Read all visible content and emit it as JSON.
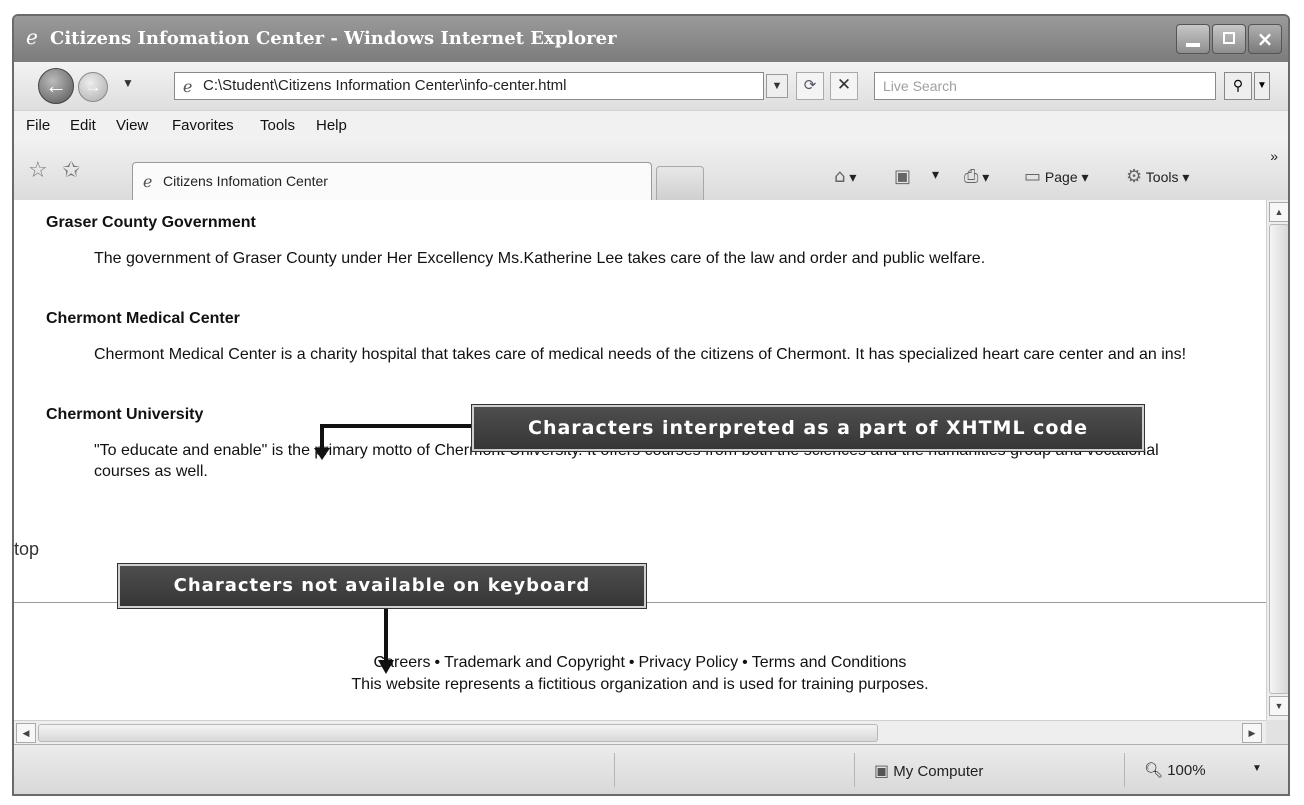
{
  "window": {
    "title": "Citizens Infomation Center - Windows Internet Explorer",
    "buttons": {
      "minimize": "minimize-icon",
      "maximize": "maximize-icon",
      "close": "×"
    }
  },
  "navbar": {
    "address": "C:\\Student\\Citizens Information Center\\info-center.html",
    "search_placeholder": "Live Search",
    "back_glyph": "←",
    "forward_glyph": "→",
    "dropdown_glyph": "▼",
    "refresh_glyph": "⟳",
    "stop_glyph": "✕",
    "search_glyph": "⚲"
  },
  "menu": {
    "items": [
      "File",
      "Edit",
      "View",
      "Favorites",
      "Tools",
      "Help"
    ]
  },
  "tabbar": {
    "tab_label": "Citizens Infomation Center",
    "page_label": "Page",
    "tools_label": "Tools",
    "more_glyph": "»"
  },
  "content": {
    "sections": [
      {
        "title": "Graser County Government",
        "body": "The government of Graser County under Her Excellency Ms.Katherine Lee takes care of the law and order and public welfare."
      },
      {
        "title": "Chermont Medical Center",
        "body": "Chermont Medical Center is a charity hospital that takes care of medical needs of the citizens of Chermont. It has specialized heart care center and an ins!"
      },
      {
        "title": "Chermont University",
        "body": "\"To educate and enable\" is the primary motto of Chermont University. It offers courses from both the sciences and the humanities group and vocational courses as well."
      }
    ],
    "top_link": "top",
    "footer_links": [
      "Careers",
      "Trademark and Copyright",
      "Privacy Policy",
      "Terms and Conditions"
    ],
    "footer_separator": "•",
    "footer_note": "This website represents a fictitious organization and is used for training purposes."
  },
  "callouts": {
    "xhtml_code": "Characters interpreted as a part of XHTML code",
    "not_on_keyboard": "Characters not available on keyboard"
  },
  "statusbar": {
    "zone": "My Computer",
    "zoom": "100%"
  }
}
